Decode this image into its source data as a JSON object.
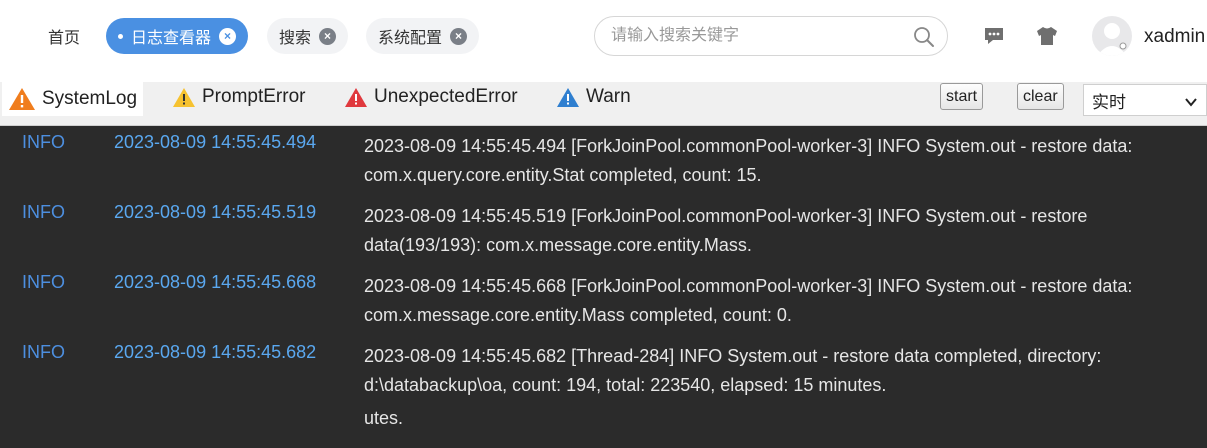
{
  "header": {
    "tabs": [
      {
        "label": "首页",
        "state": "plain",
        "closable": false
      },
      {
        "label": "日志查看器",
        "state": "active",
        "closable": true
      },
      {
        "label": "搜索",
        "state": "inactive",
        "closable": true
      },
      {
        "label": "系统配置",
        "state": "inactive",
        "closable": true
      }
    ],
    "close_glyph": "×",
    "search_placeholder": "请输入搜索关键字",
    "icons": [
      "search-icon",
      "message-icon",
      "skin-icon",
      "avatar"
    ],
    "username": "xadmin"
  },
  "toolbar": {
    "log_tabs": [
      {
        "label": "SystemLog",
        "icon": "warning-orange-icon",
        "color": "#f07d1d",
        "selected": true
      },
      {
        "label": "PromptError",
        "icon": "warning-yellow-icon",
        "color": "#f6c230",
        "selected": false
      },
      {
        "label": "UnexpectedError",
        "icon": "warning-red-icon",
        "color": "#e0393e",
        "selected": false
      },
      {
        "label": "Warn",
        "icon": "warning-blue-icon",
        "color": "#2f7fd0",
        "selected": false
      }
    ],
    "start_label": "start",
    "clear_label": "clear",
    "mode_value": "实时"
  },
  "log": {
    "entries": [
      {
        "level": "INFO",
        "time": "2023-08-09 14:55:45.494",
        "message": "2023-08-09 14:55:45.494 [ForkJoinPool.commonPool-worker-3] INFO System.out - restore data: com.x.query.core.entity.Stat completed, count: 15."
      },
      {
        "level": "INFO",
        "time": "2023-08-09 14:55:45.519",
        "message": "2023-08-09 14:55:45.519 [ForkJoinPool.commonPool-worker-3] INFO System.out - restore data(193/193): com.x.message.core.entity.Mass."
      },
      {
        "level": "INFO",
        "time": "2023-08-09 14:55:45.668",
        "message": "2023-08-09 14:55:45.668 [ForkJoinPool.commonPool-worker-3] INFO System.out - restore data: com.x.message.core.entity.Mass completed, count: 0."
      },
      {
        "level": "INFO",
        "time": "2023-08-09 14:55:45.682",
        "message": "2023-08-09 14:55:45.682 [Thread-284] INFO System.out - restore data completed, directory: d:\\databackup\\oa, count: 194, total: 223540, elapsed: 15 minutes."
      }
    ],
    "trailing_text": "utes."
  }
}
